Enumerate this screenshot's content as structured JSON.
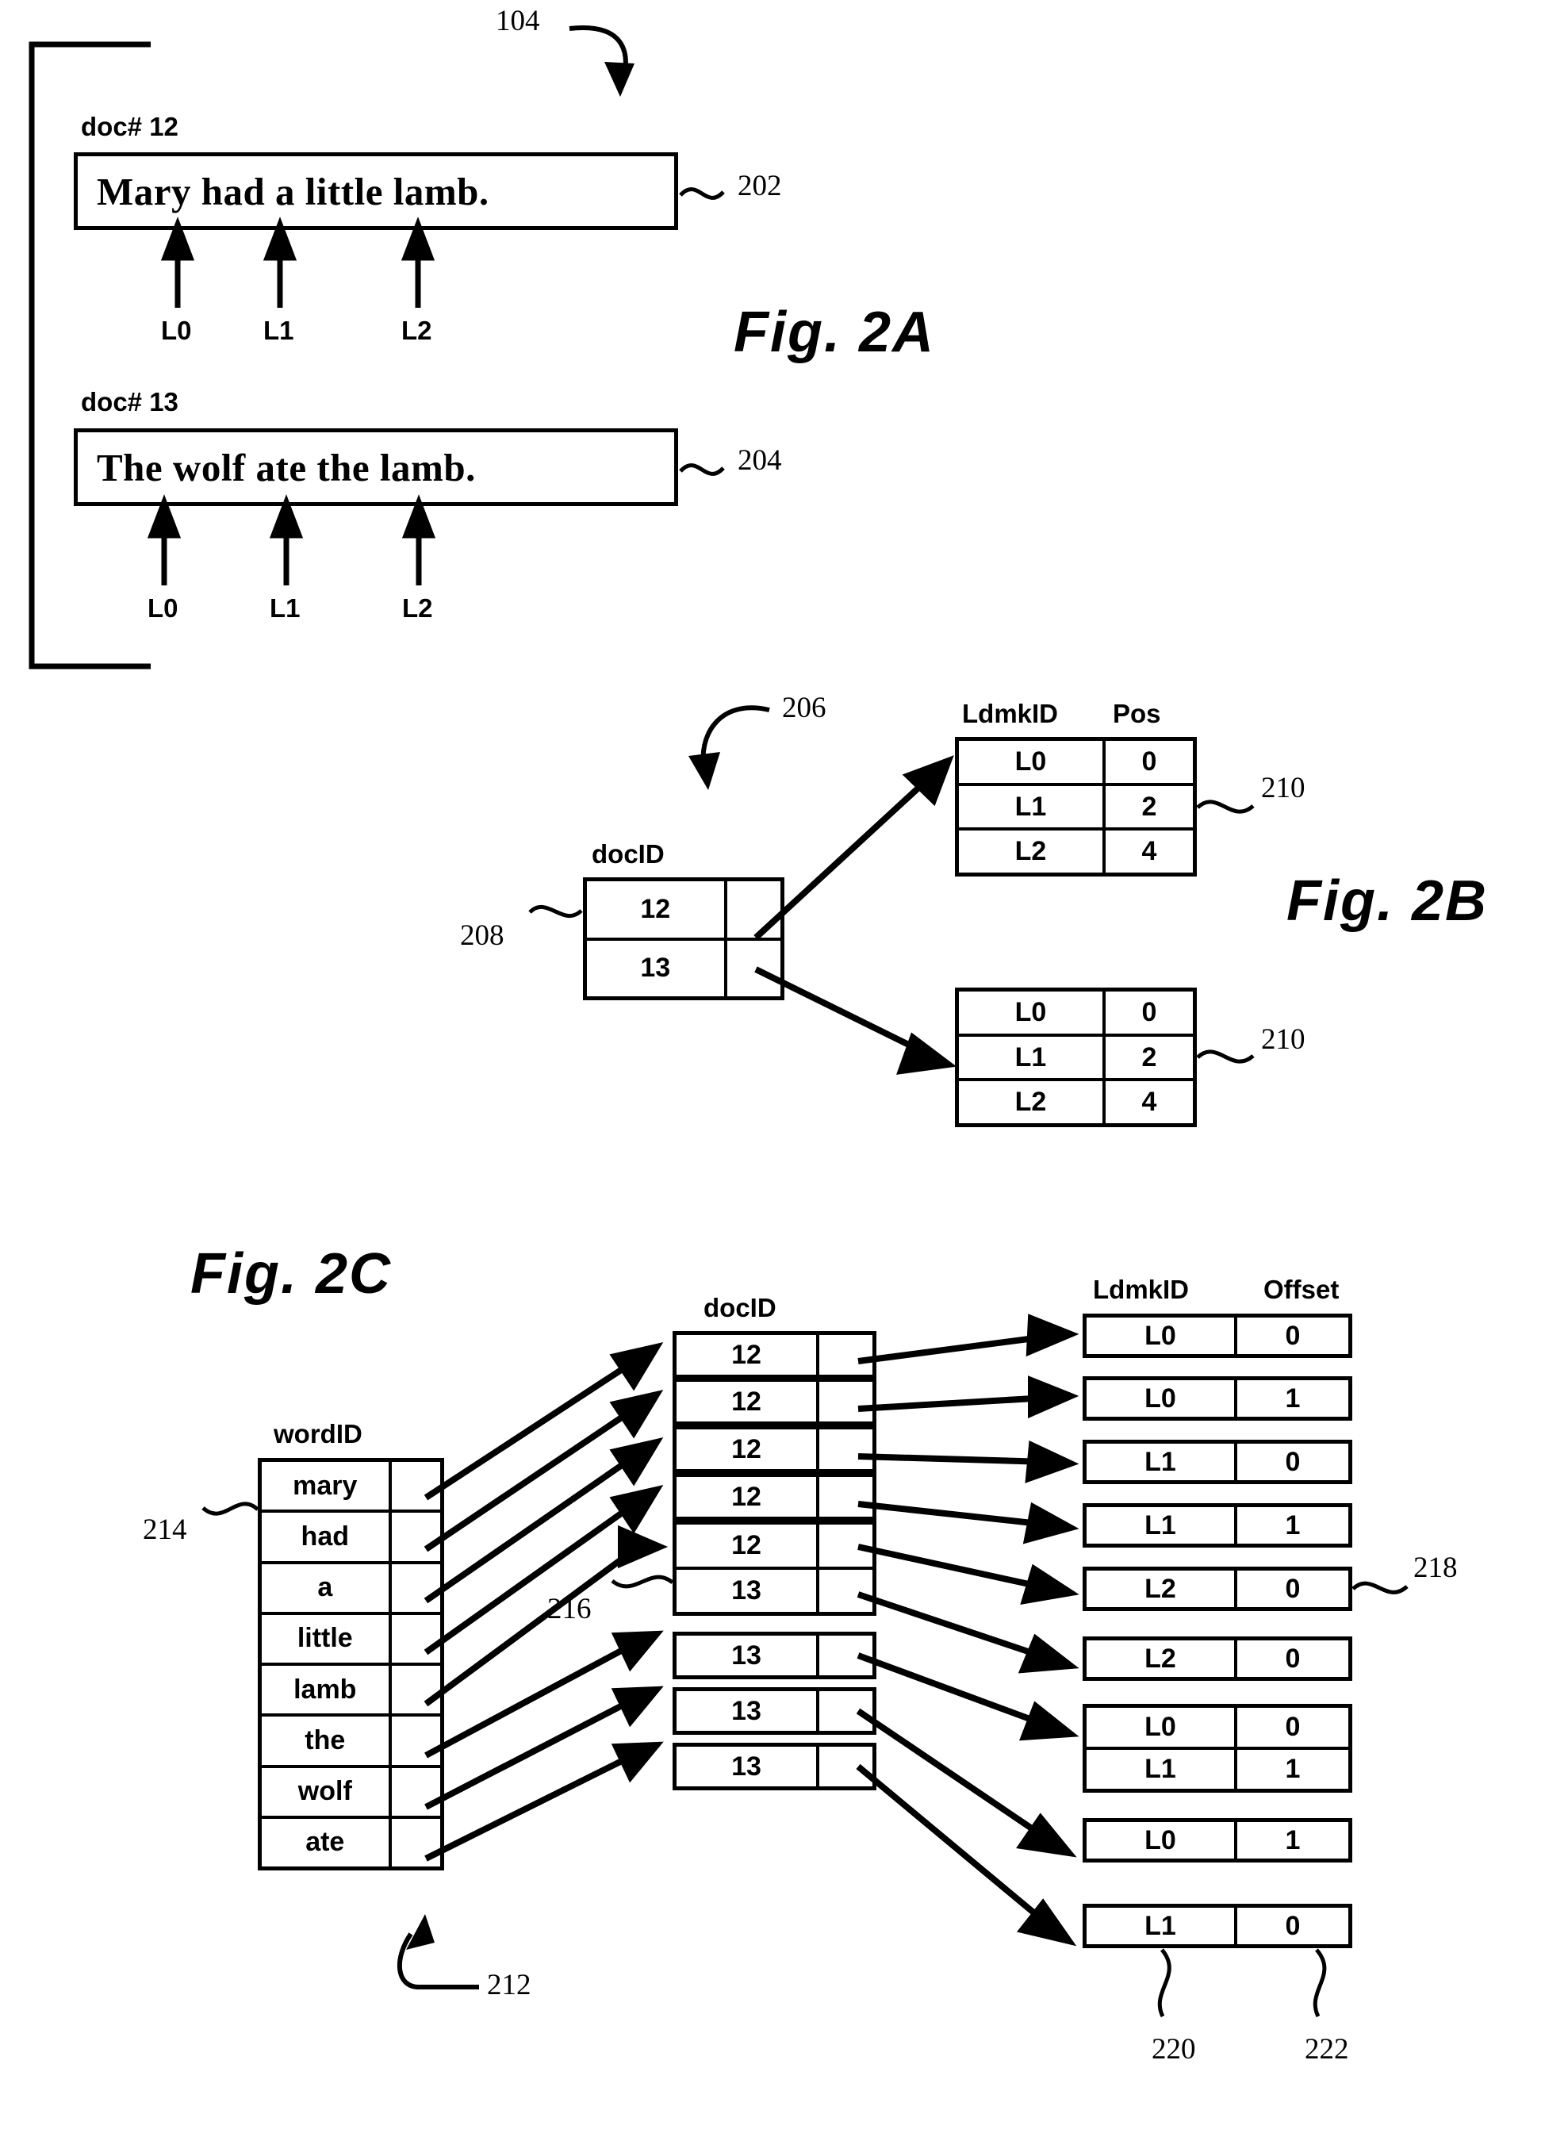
{
  "figures": {
    "fig2a": {
      "title": "Fig. 2A",
      "ref_corpus": "104",
      "documents": [
        {
          "doc_label": "doc# 12",
          "sentence": "Mary had a little lamb.",
          "ref": "202",
          "landmarks": [
            "L0",
            "L1",
            "L2"
          ]
        },
        {
          "doc_label": "doc# 13",
          "sentence": "The wolf ate the lamb.",
          "ref": "204",
          "landmarks": [
            "L0",
            "L1",
            "L2"
          ]
        }
      ]
    },
    "fig2b": {
      "title": "Fig. 2B",
      "ref_index": "206",
      "ref_doclist": "208",
      "doc_header": "docID",
      "doc_rows": [
        "12",
        "13"
      ],
      "ldmk_header": "LdmkID",
      "pos_header": "Pos",
      "ref_table_a": "210",
      "ref_table_b": "210",
      "table_a": [
        {
          "ldmk": "L0",
          "pos": "0"
        },
        {
          "ldmk": "L1",
          "pos": "2"
        },
        {
          "ldmk": "L2",
          "pos": "4"
        }
      ],
      "table_b": [
        {
          "ldmk": "L0",
          "pos": "0"
        },
        {
          "ldmk": "L1",
          "pos": "2"
        },
        {
          "ldmk": "L2",
          "pos": "4"
        }
      ]
    },
    "fig2c": {
      "title": "Fig. 2C",
      "ref_index": "212",
      "ref_wordlist": "214",
      "ref_doclist": "216",
      "ref_ldmklist": "218",
      "ref_ldmk_col": "220",
      "ref_offset_col": "222",
      "word_header": "wordID",
      "words": [
        "mary",
        "had",
        "a",
        "little",
        "lamb",
        "the",
        "wolf",
        "ate"
      ],
      "doc_header": "docID",
      "doc_groups": [
        {
          "rows": [
            "12"
          ]
        },
        {
          "rows": [
            "12"
          ]
        },
        {
          "rows": [
            "12"
          ]
        },
        {
          "rows": [
            "12"
          ]
        },
        {
          "rows": [
            "12",
            "13"
          ]
        },
        {
          "rows": [
            "13"
          ]
        },
        {
          "rows": [
            "13"
          ]
        },
        {
          "rows": [
            "13"
          ]
        }
      ],
      "ldmk_header": "LdmkID",
      "offset_header": "Offset",
      "ldmk_groups": [
        {
          "rows": [
            {
              "ldmk": "L0",
              "offset": "0"
            }
          ]
        },
        {
          "rows": [
            {
              "ldmk": "L0",
              "offset": "1"
            }
          ]
        },
        {
          "rows": [
            {
              "ldmk": "L1",
              "offset": "0"
            }
          ]
        },
        {
          "rows": [
            {
              "ldmk": "L1",
              "offset": "1"
            }
          ]
        },
        {
          "rows": [
            {
              "ldmk": "L2",
              "offset": "0"
            }
          ]
        },
        {
          "rows": [
            {
              "ldmk": "L2",
              "offset": "0"
            }
          ]
        },
        {
          "rows": [
            {
              "ldmk": "L0",
              "offset": "0"
            },
            {
              "ldmk": "L1",
              "offset": "1"
            }
          ]
        },
        {
          "rows": [
            {
              "ldmk": "L0",
              "offset": "1"
            }
          ]
        },
        {
          "rows": [
            {
              "ldmk": "L1",
              "offset": "0"
            }
          ]
        }
      ]
    }
  }
}
